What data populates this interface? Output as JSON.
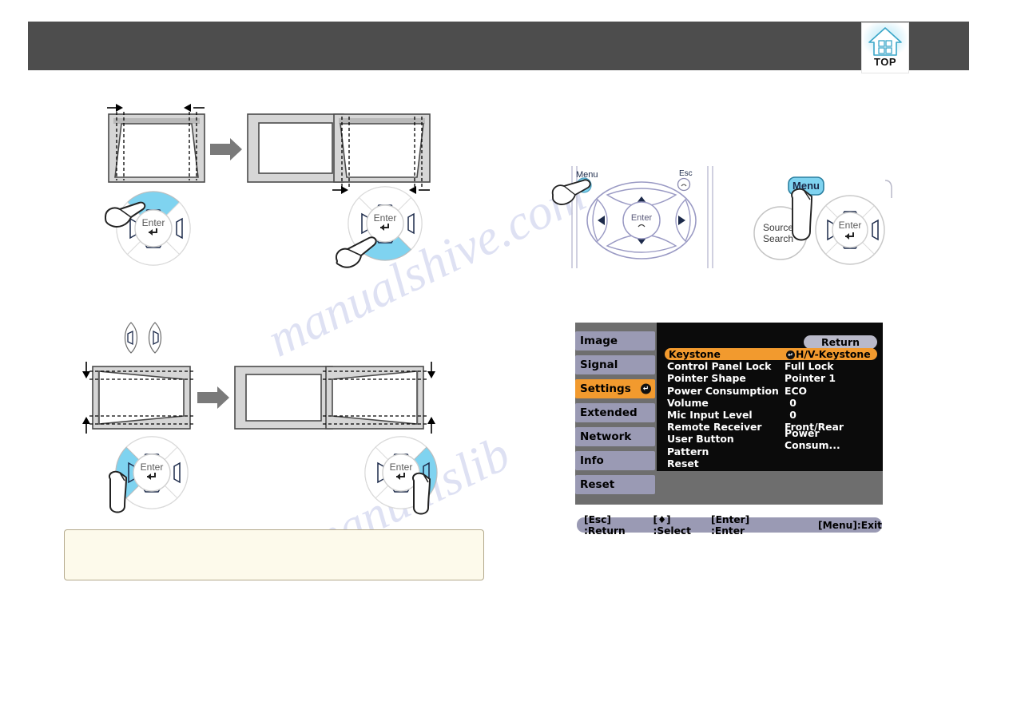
{
  "header": {
    "bar_color": "#4d4d4d",
    "top_badge": {
      "label": "TOP",
      "icon": "home-icon"
    }
  },
  "watermark": {
    "line1": "manualshive.com",
    "line2": "manualslib"
  },
  "diagrams": {
    "row1": {
      "caption": "vertical-keystone-correction",
      "left_screen": "trapezoid-narrow-top",
      "center_screen": "corrected-rectangle",
      "right_screen": "trapezoid-wide-top",
      "left_pad": {
        "highlight": "up",
        "icon": "keystone-up-icon",
        "enter_label": "Enter"
      },
      "right_pad": {
        "highlight": "down",
        "icon": "keystone-down-icon",
        "enter_label": "Enter"
      }
    },
    "row2": {
      "caption": "horizontal-keystone-correction",
      "left_screen": "trapezoid-narrow-right",
      "center_screen": "corrected-rectangle",
      "right_screen": "trapezoid-narrow-left",
      "left_pad": {
        "highlight": "left",
        "icon": "keystone-left-icon",
        "enter_label": "Enter"
      },
      "right_pad": {
        "highlight": "right",
        "icon": "keystone-right-icon",
        "enter_label": "Enter"
      }
    }
  },
  "remote": {
    "menu_label": "Menu",
    "esc_label": "Esc",
    "enter_label": "Enter"
  },
  "control_panel": {
    "menu_label": "Menu",
    "source_search_label_line1": "Source",
    "source_search_label_line2": "Search",
    "enter_label": "Enter"
  },
  "osd": {
    "accent_color": "#f29a2e",
    "sidebar_color": "#9a9ab4",
    "panel_color": "#0b0b0b",
    "background_color": "#6e6e6e",
    "return_label": "Return",
    "sidebar": [
      {
        "label": "Image",
        "active": false
      },
      {
        "label": "Signal",
        "active": false
      },
      {
        "label": "Settings",
        "active": true
      },
      {
        "label": "Extended",
        "active": false
      },
      {
        "label": "Network",
        "active": false
      },
      {
        "label": "Info",
        "active": false
      },
      {
        "label": "Reset",
        "active": false
      }
    ],
    "rows": [
      {
        "label": "Keystone",
        "value": "H/V-Keystone",
        "selected": true,
        "enter_icon": true,
        "center": false
      },
      {
        "label": "Control Panel Lock",
        "value": "Full Lock",
        "selected": false,
        "enter_icon": false,
        "center": false
      },
      {
        "label": "Pointer Shape",
        "value": "Pointer 1",
        "selected": false,
        "enter_icon": false,
        "center": false
      },
      {
        "label": "Power Consumption",
        "value": "ECO",
        "selected": false,
        "enter_icon": false,
        "center": false
      },
      {
        "label": "Volume",
        "value": "0",
        "selected": false,
        "enter_icon": false,
        "center": true
      },
      {
        "label": "Mic Input Level",
        "value": "0",
        "selected": false,
        "enter_icon": false,
        "center": true
      },
      {
        "label": "Remote Receiver",
        "value": "Front/Rear",
        "selected": false,
        "enter_icon": false,
        "center": false
      },
      {
        "label": "User Button",
        "value": "Power Consum...",
        "selected": false,
        "enter_icon": false,
        "center": false
      },
      {
        "label": "Pattern",
        "value": "",
        "selected": false,
        "enter_icon": false,
        "center": false
      },
      {
        "label": "Reset",
        "value": "",
        "selected": false,
        "enter_icon": false,
        "center": false
      }
    ],
    "status": {
      "esc": "[Esc] :Return",
      "select": "[♦] :Select",
      "enter": "[Enter] :Enter",
      "exit": "[Menu]:Exit"
    }
  },
  "note_box": {
    "text": ""
  }
}
